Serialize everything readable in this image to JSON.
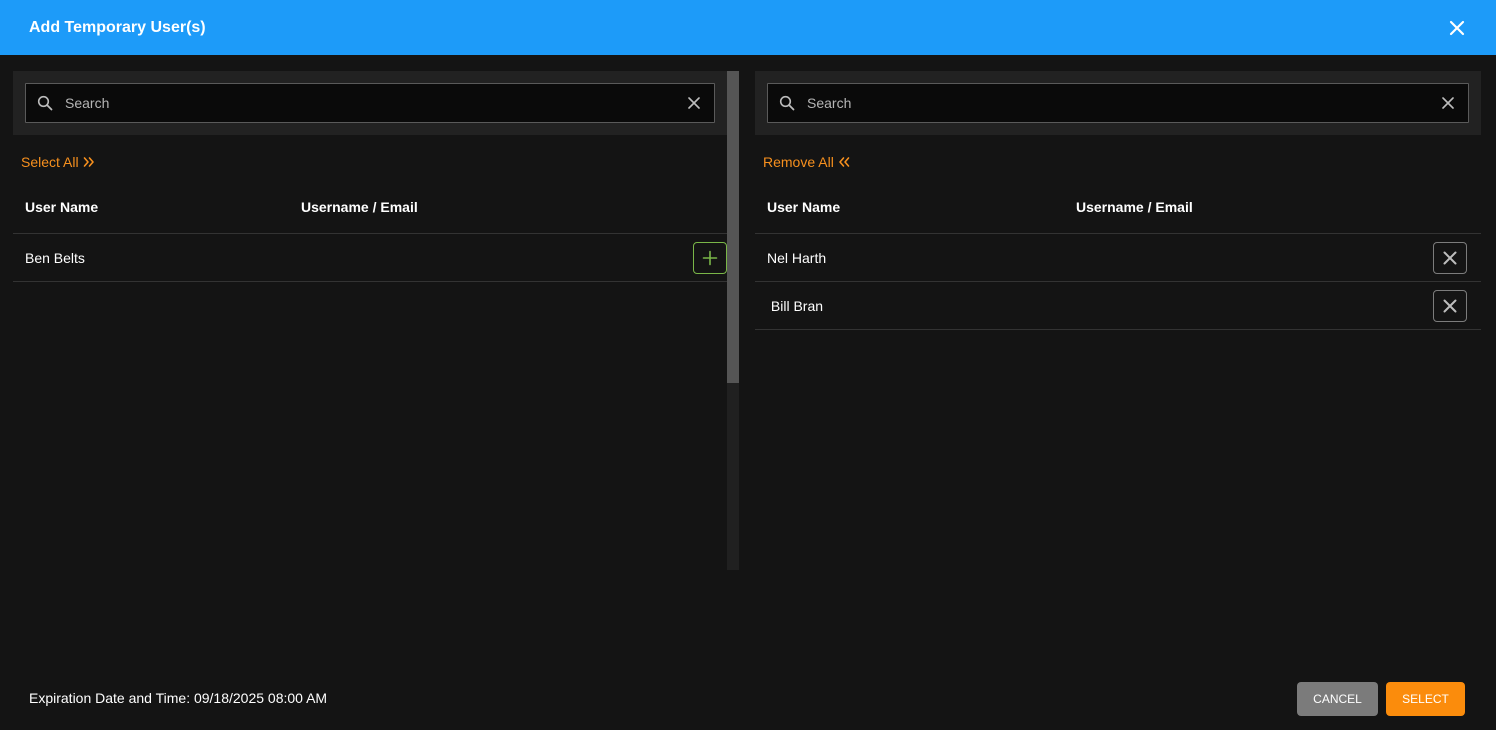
{
  "header": {
    "title": "Add Temporary User(s)"
  },
  "left_panel": {
    "search": {
      "placeholder": "Search",
      "value": ""
    },
    "bulk_label": "Select All",
    "columns": [
      "User Name",
      "Username / Email"
    ],
    "rows": [
      {
        "name": "Ben Belts",
        "email": ""
      }
    ]
  },
  "right_panel": {
    "search": {
      "placeholder": "Search",
      "value": ""
    },
    "bulk_label": "Remove All",
    "columns": [
      "User Name",
      "Username / Email"
    ],
    "rows": [
      {
        "name": "Nel Harth",
        "email": ""
      },
      {
        "name": " Bill Bran",
        "email": ""
      }
    ]
  },
  "footer": {
    "expiration_text": "Expiration Date and Time: 09/18/2025 08:00 AM",
    "cancel_label": "CANCEL",
    "select_label": "SELECT"
  },
  "colors": {
    "header_bg": "#1d9bf9",
    "accent_orange": "#f7901e",
    "add_green": "#7ab648",
    "background": "#141414"
  }
}
